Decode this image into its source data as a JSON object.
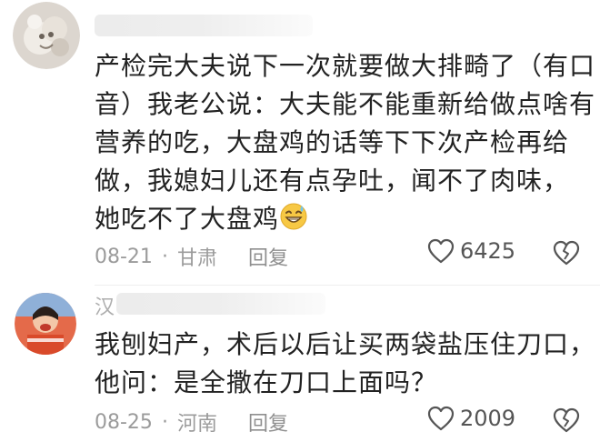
{
  "comments": [
    {
      "username": "",
      "lines": [
        "产检完大夫说下一次就要做大排畸了（有口",
        "音）我老公说：大夫能不能重新给做点啥有",
        "营养的吃，大盘鸡的话等下下次产检再给",
        "做，我媳妇儿还有点孕吐，闻不了肉味，",
        "她吃不了大盘鸡"
      ],
      "date": "08-21",
      "location": "甘肃",
      "reply_label": "回复",
      "likes": "6425"
    },
    {
      "username": "汉",
      "lines": [
        "我刨妇产，术后以后让买两袋盐压住刀口，",
        "他问：是全撒在刀口上面吗？"
      ],
      "date": "08-25",
      "location": "河南",
      "reply_label": "回复",
      "likes": "2009"
    }
  ],
  "separator": "·",
  "icons": {
    "emoji": "grinning-sweat-emoji",
    "like": "heart-outline-icon",
    "dislike": "broken-heart-icon"
  },
  "colors": {
    "text": "#222222",
    "meta": "#9b9b9b",
    "icon": "#555555"
  }
}
